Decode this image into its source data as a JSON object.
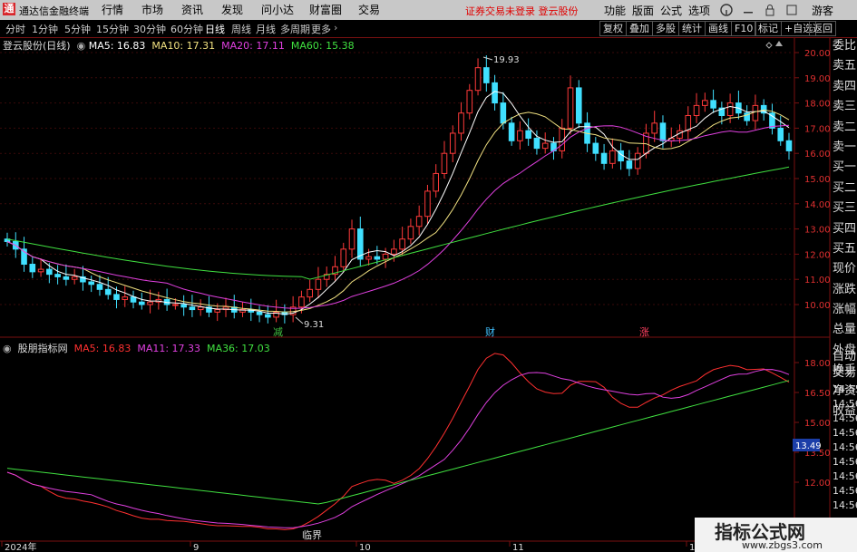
{
  "titlebar": {
    "logo": "通",
    "app_title": "通达信金融终端",
    "menus": [
      "行情",
      "市场",
      "资讯",
      "发现",
      "问小达",
      "财富圈",
      "交易"
    ],
    "warning": "证券交易未登录  登云股份",
    "right_menus": [
      "功能",
      "版面",
      "公式",
      "选项"
    ],
    "guest": "游客"
  },
  "toolbar": {
    "periods": [
      "分时",
      "1分钟",
      "5分钟",
      "15分钟",
      "30分钟",
      "60分钟",
      "日线",
      "周线",
      "月线",
      "多周期",
      "更多"
    ],
    "active_period": "日线",
    "buttons": [
      "复权",
      "叠加",
      "多股",
      "统计",
      "画线",
      "F10",
      "标记",
      "+自选",
      "返回"
    ]
  },
  "main_chart": {
    "stock_label": "登云股份(日线)",
    "ma": [
      {
        "label": "MA5: 16.83",
        "color": "#ffffff"
      },
      {
        "label": "MA10: 17.31",
        "color": "#f0e080"
      },
      {
        "label": "MA20: 17.11",
        "color": "#e040e0"
      },
      {
        "label": "MA60: 15.38",
        "color": "#40e040"
      }
    ],
    "y_ticks": [
      "20.00",
      "19.00",
      "18.00",
      "17.00",
      "16.00",
      "15.00",
      "14.00",
      "13.00",
      "12.00",
      "11.00",
      "10.00"
    ],
    "high_label": "19.93",
    "low_label": "9.31",
    "markers": [
      {
        "text": "减",
        "color": "#40c040"
      },
      {
        "text": "财",
        "color": "#40c0ff"
      },
      {
        "text": "涨",
        "color": "#ff4060"
      }
    ]
  },
  "sub_chart": {
    "name": "股朋指标网",
    "ma": [
      {
        "label": "MA5: 16.83",
        "color": "#ff3030"
      },
      {
        "label": "MA11: 17.33",
        "color": "#e040e0"
      },
      {
        "label": "MA36: 17.03",
        "color": "#40e040"
      }
    ],
    "y_ticks": [
      "18.00",
      "16.50",
      "15.00",
      "13.50",
      "12.00"
    ],
    "current_value": "13.49",
    "marker": "临界"
  },
  "x_axis": [
    "2024年",
    "9",
    "10",
    "11",
    "12"
  ],
  "right_panel": [
    "委比",
    "卖五",
    "卖四",
    "卖三",
    "卖二",
    "卖一",
    "买一",
    "买二",
    "买三",
    "买四",
    "买五",
    "现价",
    "涨跌",
    "涨幅",
    "总量",
    "外盘",
    "换手",
    "净资",
    "收益"
  ],
  "right_panel2": [
    "自动",
    "交易",
    "14:55",
    "14:56",
    "14:56",
    "14:56",
    "14:56",
    "14:56",
    "14:56",
    "14:56",
    "14:56"
  ],
  "watermark": {
    "text": "指标公式网",
    "url": "www.zbgs3.com"
  }
}
